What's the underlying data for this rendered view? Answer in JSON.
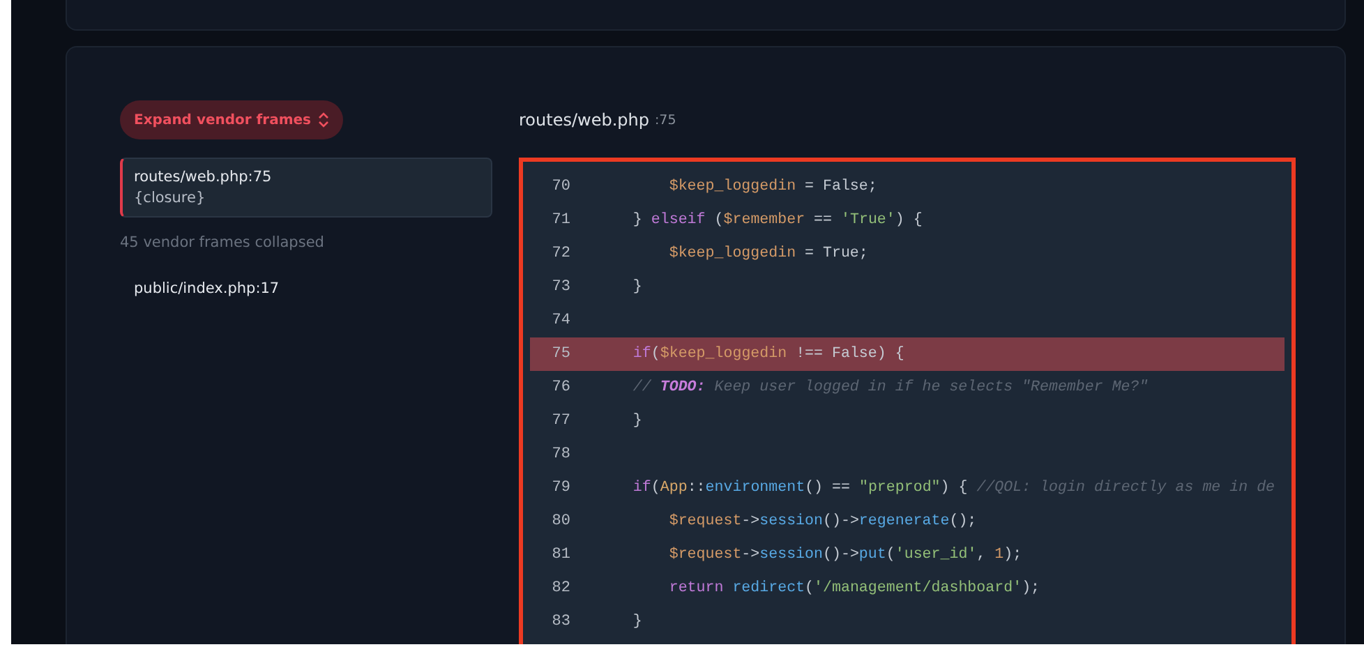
{
  "expand_button": {
    "label": "Expand vendor frames"
  },
  "frames": [
    {
      "kind": "frame",
      "file": "routes/web.php",
      "line": ":75",
      "function": "{closure}",
      "selected": true
    },
    {
      "kind": "collapsed",
      "label": "45 vendor frames collapsed"
    },
    {
      "kind": "frame",
      "file": "public/index.php",
      "line": ":17",
      "selected": false
    }
  ],
  "source": {
    "file": "routes/web.php",
    "line": ":75",
    "lines": [
      {
        "number": "70",
        "highlighted": false,
        "tokens": [
          {
            "kind": "var",
            "text": "        $keep_loggedin"
          },
          {
            "kind": "plain",
            "text": " = False;"
          }
        ]
      },
      {
        "number": "71",
        "highlighted": false,
        "tokens": [
          {
            "kind": "plain",
            "text": "    } "
          },
          {
            "kind": "keyword",
            "text": "elseif"
          },
          {
            "kind": "plain",
            "text": " ("
          },
          {
            "kind": "var",
            "text": "$remember"
          },
          {
            "kind": "plain",
            "text": " == "
          },
          {
            "kind": "string",
            "text": "'True'"
          },
          {
            "kind": "plain",
            "text": ") {"
          }
        ]
      },
      {
        "number": "72",
        "highlighted": false,
        "tokens": [
          {
            "kind": "var",
            "text": "        $keep_loggedin"
          },
          {
            "kind": "plain",
            "text": " = True;"
          }
        ]
      },
      {
        "number": "73",
        "highlighted": false,
        "tokens": [
          {
            "kind": "plain",
            "text": "    }"
          }
        ]
      },
      {
        "number": "74",
        "highlighted": false
      },
      {
        "number": "75",
        "highlighted": true,
        "tokens": [
          {
            "kind": "keyword",
            "text": "    if"
          },
          {
            "kind": "plain",
            "text": "("
          },
          {
            "kind": "var",
            "text": "$keep_loggedin"
          },
          {
            "kind": "plain",
            "text": " !== False) {"
          }
        ]
      },
      {
        "number": "76",
        "highlighted": false,
        "tokens": [
          {
            "kind": "comment",
            "text": "    // "
          },
          {
            "kind": "todo",
            "text": "TODO:"
          },
          {
            "kind": "comment",
            "text": " Keep user logged in if he selects \"Remember Me?\""
          }
        ]
      },
      {
        "number": "77",
        "highlighted": false,
        "tokens": [
          {
            "kind": "plain",
            "text": "    }"
          }
        ]
      },
      {
        "number": "78",
        "highlighted": false
      },
      {
        "number": "79",
        "highlighted": false,
        "tokens": [
          {
            "kind": "keyword",
            "text": "    if"
          },
          {
            "kind": "plain",
            "text": "("
          },
          {
            "kind": "class",
            "text": "App"
          },
          {
            "kind": "plain",
            "text": "::"
          },
          {
            "kind": "func",
            "text": "environment"
          },
          {
            "kind": "plain",
            "text": "() == "
          },
          {
            "kind": "string",
            "text": "\"preprod\""
          },
          {
            "kind": "plain",
            "text": ") { "
          },
          {
            "kind": "comment",
            "text": "//QOL: login directly as me in de"
          }
        ]
      },
      {
        "number": "80",
        "highlighted": false,
        "tokens": [
          {
            "kind": "var",
            "text": "        $request"
          },
          {
            "kind": "plain",
            "text": "->"
          },
          {
            "kind": "func",
            "text": "session"
          },
          {
            "kind": "plain",
            "text": "()->"
          },
          {
            "kind": "func",
            "text": "regenerate"
          },
          {
            "kind": "plain",
            "text": "();"
          }
        ]
      },
      {
        "number": "81",
        "highlighted": false,
        "tokens": [
          {
            "kind": "var",
            "text": "        $request"
          },
          {
            "kind": "plain",
            "text": "->"
          },
          {
            "kind": "func",
            "text": "session"
          },
          {
            "kind": "plain",
            "text": "()->"
          },
          {
            "kind": "func",
            "text": "put"
          },
          {
            "kind": "plain",
            "text": "("
          },
          {
            "kind": "string",
            "text": "'user_id'"
          },
          {
            "kind": "plain",
            "text": ", "
          },
          {
            "kind": "number",
            "text": "1"
          },
          {
            "kind": "plain",
            "text": ");"
          }
        ]
      },
      {
        "number": "82",
        "highlighted": false,
        "tokens": [
          {
            "kind": "keyword",
            "text": "        return"
          },
          {
            "kind": "func",
            "text": " redirect"
          },
          {
            "kind": "plain",
            "text": "("
          },
          {
            "kind": "string",
            "text": "'/management/dashboard'"
          },
          {
            "kind": "plain",
            "text": ");"
          }
        ]
      },
      {
        "number": "83",
        "highlighted": false,
        "tokens": [
          {
            "kind": "plain",
            "text": "    }"
          }
        ]
      }
    ]
  }
}
